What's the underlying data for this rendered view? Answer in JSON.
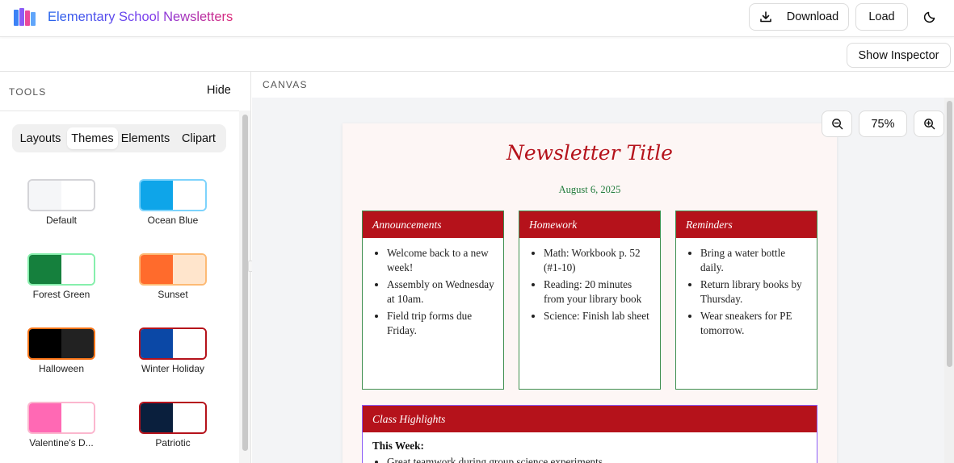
{
  "header": {
    "title": "Elementary School Newsletters",
    "download_label": "Download",
    "load_label": "Load"
  },
  "subbar": {
    "inspector_label": "Show Inspector"
  },
  "sidebar": {
    "tools_label": "TOOLS",
    "hide_label": "Hide",
    "tabs": [
      {
        "label": "Layouts",
        "active": false
      },
      {
        "label": "Themes",
        "active": true
      },
      {
        "label": "Elements",
        "active": false
      },
      {
        "label": "Clipart",
        "active": false
      }
    ],
    "themes": [
      {
        "label": "Default",
        "colors": [
          "#f5f6f8",
          "#ffffff"
        ],
        "border": "#d4d4d8"
      },
      {
        "label": "Ocean Blue",
        "colors": [
          "#0ea5e9",
          "#ffffff"
        ],
        "border": "#7dd3fc"
      },
      {
        "label": "Forest Green",
        "colors": [
          "#15803d",
          "#ffffff"
        ],
        "border": "#86efac"
      },
      {
        "label": "Sunset",
        "colors": [
          "#ff6b2c",
          "#ffe5cc"
        ],
        "border": "#fdba74"
      },
      {
        "label": "Halloween",
        "colors": [
          "#000000",
          "#222222"
        ],
        "border": "#f97316"
      },
      {
        "label": "Winter Holiday",
        "colors": [
          "#0b48a6",
          "#ffffff"
        ],
        "border": "#b5121b"
      },
      {
        "label": "Valentine's D...",
        "colors": [
          "#ff69b4",
          "#ffffff"
        ],
        "border": "#fbb6ce"
      },
      {
        "label": "Patriotic",
        "colors": [
          "#0a1f3d",
          "#ffffff"
        ],
        "border": "#b5121b"
      }
    ]
  },
  "canvas": {
    "label": "CANVAS",
    "zoom": "75%"
  },
  "newsletter": {
    "title": "Newsletter Title",
    "date": "August 6, 2025",
    "boxes": [
      {
        "heading": "Announcements",
        "items": [
          "Welcome back to a new week!",
          "Assembly on Wednesday at 10am.",
          "Field trip forms due Friday."
        ]
      },
      {
        "heading": "Homework",
        "items": [
          "Math: Workbook p. 52 (#1-10)",
          "Reading: 20 minutes from your library book",
          "Science: Finish lab sheet"
        ]
      },
      {
        "heading": "Reminders",
        "items": [
          "Bring a water bottle daily.",
          "Return library books by Thursday.",
          "Wear sneakers for PE tomorrow."
        ]
      }
    ],
    "highlights": {
      "heading": "Class Highlights",
      "subheading": "This Week:",
      "items": [
        "Great teamwork during group science experiments"
      ]
    }
  }
}
